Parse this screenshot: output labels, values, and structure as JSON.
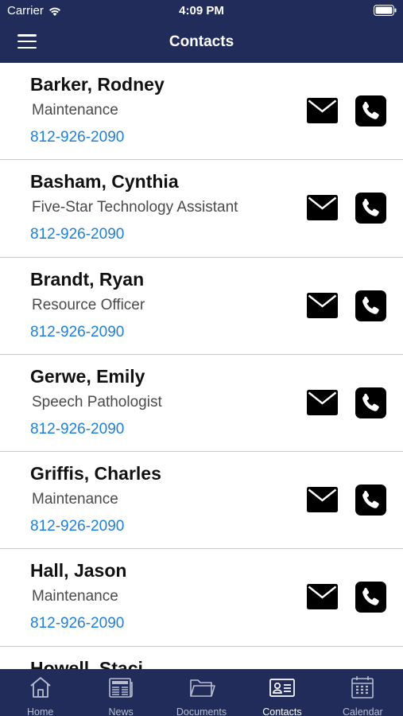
{
  "status": {
    "carrier": "Carrier",
    "time": "4:09 PM"
  },
  "nav": {
    "title": "Contacts"
  },
  "contacts": [
    {
      "name": "Barker, Rodney",
      "title": "Maintenance",
      "phone": "812-926-2090"
    },
    {
      "name": "Basham, Cynthia",
      "title": "Five-Star Technology Assistant",
      "phone": "812-926-2090"
    },
    {
      "name": "Brandt, Ryan",
      "title": "Resource Officer",
      "phone": "812-926-2090"
    },
    {
      "name": "Gerwe, Emily",
      "title": "Speech Pathologist",
      "phone": "812-926-2090"
    },
    {
      "name": "Griffis, Charles",
      "title": "Maintenance",
      "phone": "812-926-2090"
    },
    {
      "name": "Hall, Jason",
      "title": "Maintenance",
      "phone": "812-926-2090"
    },
    {
      "name": "Howell, Staci",
      "title": "",
      "phone": ""
    }
  ],
  "tabs": [
    {
      "label": "Home",
      "icon": "home-icon",
      "active": false
    },
    {
      "label": "News",
      "icon": "news-icon",
      "active": false
    },
    {
      "label": "Documents",
      "icon": "folder-icon",
      "active": false
    },
    {
      "label": "Contacts",
      "icon": "contact-card-icon",
      "active": true
    },
    {
      "label": "Calendar",
      "icon": "calendar-icon",
      "active": false
    }
  ],
  "colors": {
    "header": "#212c5a",
    "link": "#1e7fd8",
    "tab_inactive": "#b8bdd0",
    "tab_active": "#ffffff"
  }
}
